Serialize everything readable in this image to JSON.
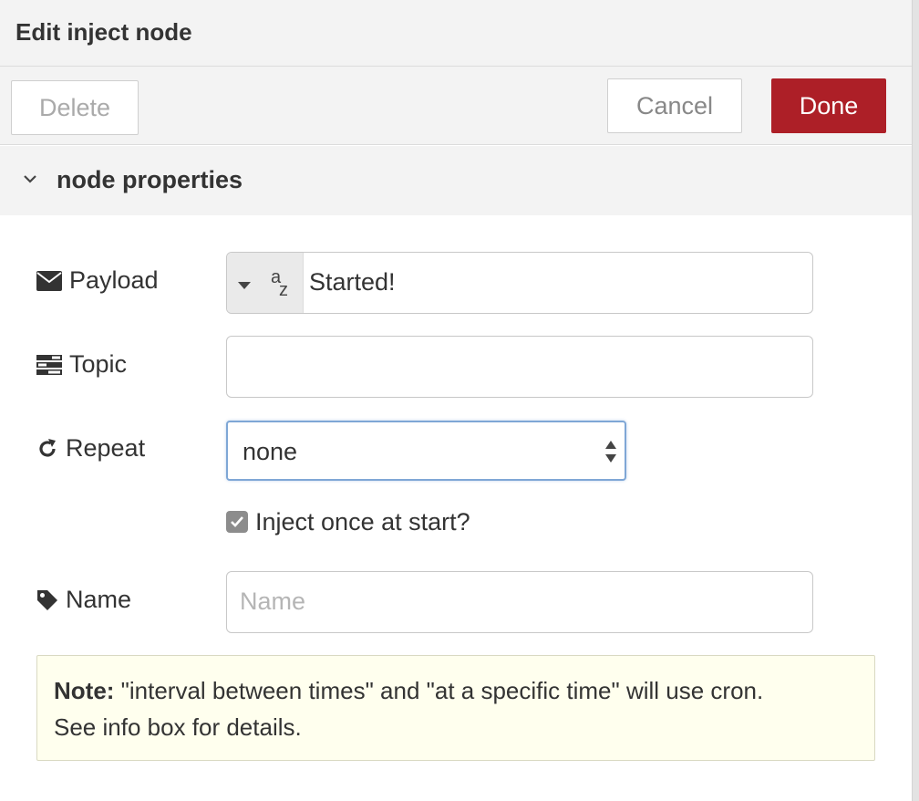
{
  "title": "Edit inject node",
  "toolbar": {
    "delete_label": "Delete",
    "cancel_label": "Cancel",
    "done_label": "Done"
  },
  "section": {
    "title": "node properties"
  },
  "form": {
    "payload": {
      "label": "Payload",
      "type_icon": "az-string-icon",
      "value": "Started!"
    },
    "topic": {
      "label": "Topic",
      "value": ""
    },
    "repeat": {
      "label": "Repeat",
      "selected": "none"
    },
    "inject_once": {
      "label": "Inject once at start?",
      "checked": true
    },
    "name": {
      "label": "Name",
      "value": "",
      "placeholder": "Name"
    }
  },
  "note": {
    "prefix": "Note:",
    "text": " \"interval between times\" and \"at a specific time\" will use cron.",
    "line2": "See info box for details."
  },
  "colors": {
    "done_button": "#ad1f27",
    "select_focus": "#7fa7d6",
    "note_background": "#ffffee"
  }
}
